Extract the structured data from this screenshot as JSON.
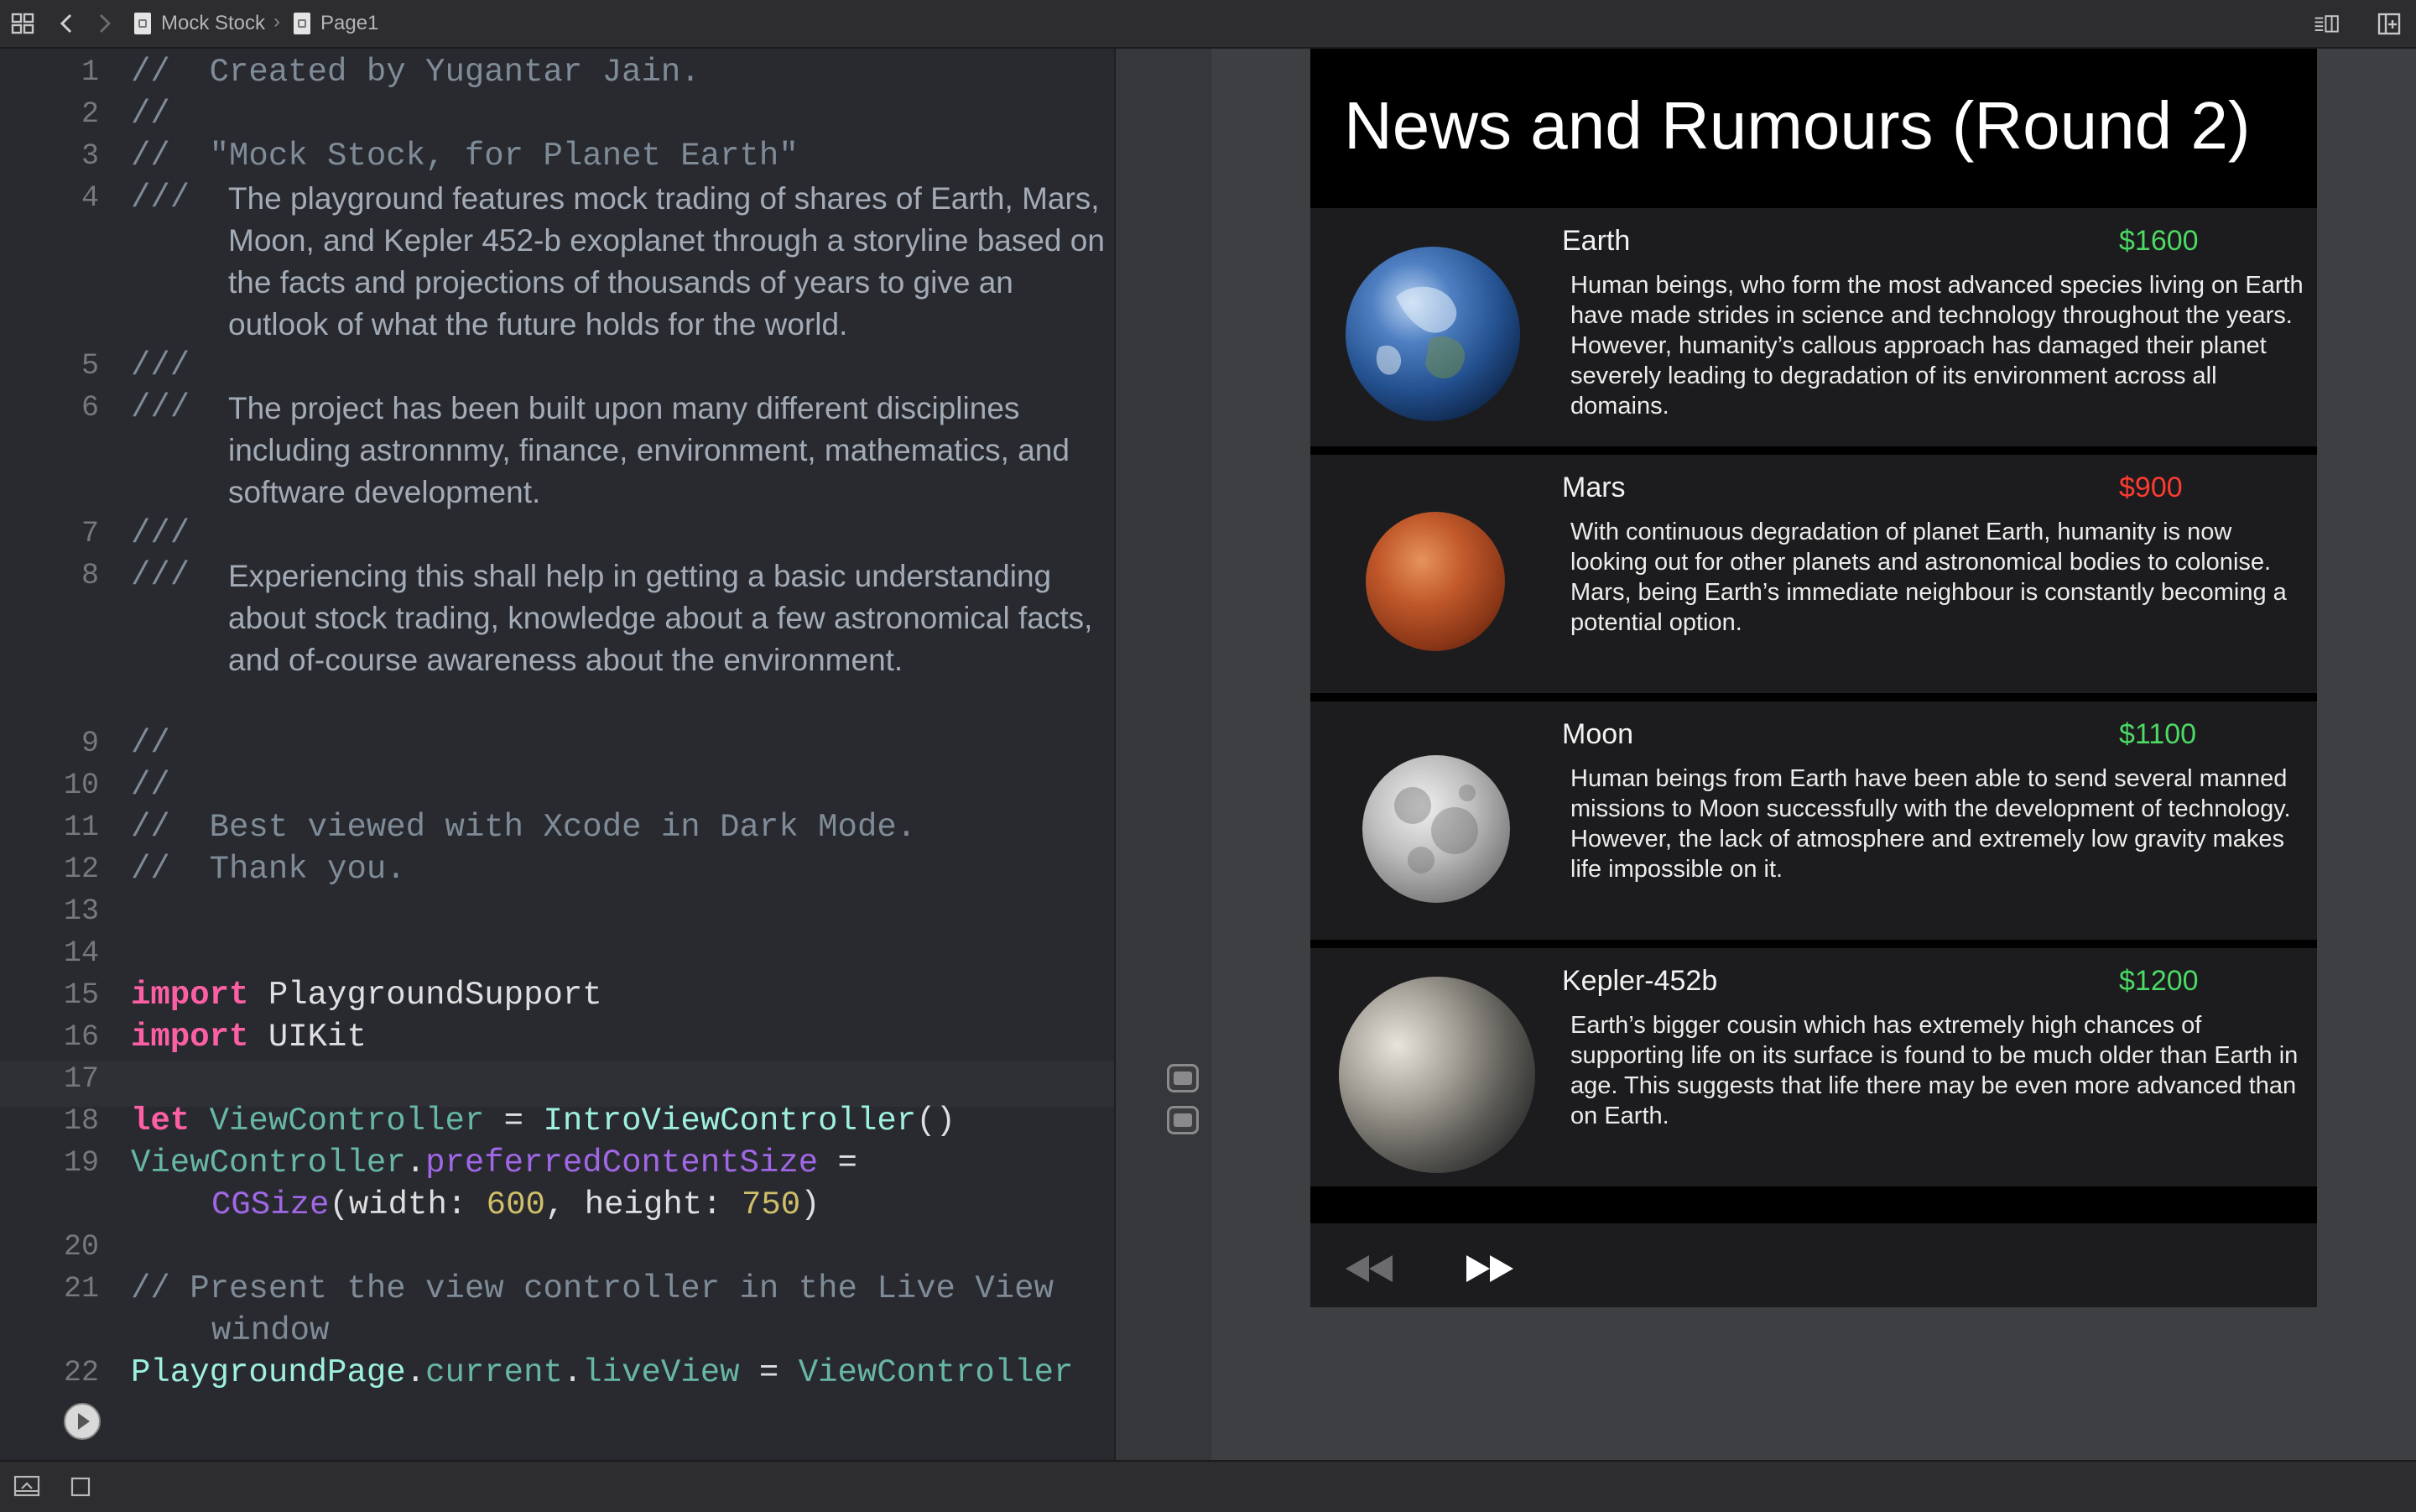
{
  "toolbar": {
    "breadcrumb": [
      {
        "label": "Mock Stock"
      },
      {
        "label": "Page1"
      }
    ],
    "separator": "›"
  },
  "editor": {
    "line_numbers": [
      "1",
      "2",
      "3",
      "4",
      "5",
      "6",
      "7",
      "8",
      "9",
      "10",
      "11",
      "12",
      "13",
      "14",
      "15",
      "16",
      "17",
      "18",
      "19",
      "20",
      "21",
      "22"
    ],
    "lines": {
      "l1": "//  Created by Yugantar Jain.",
      "l2": "//",
      "l3": "//  \"Mock Stock, for Planet Earth\"",
      "l4_marker": "///",
      "l4_doc": "The playground features mock trading of shares of Earth, Mars, Moon, and Kepler 452-b exoplanet through a storyline based on the facts and projections of thousands of years to give an outlook of what the future holds for the world.",
      "l5": "///",
      "l6_marker": "///",
      "l6_doc": "The project has been built upon many different disciplines including astronnmy, finance, environment, mathematics, and software development.",
      "l7": "///",
      "l8_marker": "///",
      "l8_doc": "Experiencing this shall help in getting a basic understanding about stock trading, knowledge about a few astronomical facts, and of-course awareness about the environment.",
      "l9": "//",
      "l10": "//",
      "l11": "//  Best viewed with Xcode in Dark Mode.",
      "l12": "//  Thank you.",
      "l15_kw": "import",
      "l15_rest": " PlaygroundSupport",
      "l16_kw": "import",
      "l16_rest": " UIKit",
      "l18_kw": "let",
      "l18_var": "ViewController",
      "l18_eq": " = ",
      "l18_type": "IntroViewController",
      "l18_end": "()",
      "l19_var": "ViewController",
      "l19_dot": ".",
      "l19_prop": "preferredContentSize",
      "l19_end": " =",
      "l19b_type": "CGSize",
      "l19b_a": "(width: ",
      "l19b_w": "600",
      "l19b_b": ", height: ",
      "l19b_h": "750",
      "l19b_c": ")",
      "l21a": "// Present the view controller in the Live View",
      "l21b": "window",
      "l22_type": "PlaygroundPage",
      "l22_d1": ".",
      "l22_p1": "current",
      "l22_d2": ".",
      "l22_p2": "liveView",
      "l22_eq": " = ",
      "l22_var": "ViewController"
    }
  },
  "live_view": {
    "title": "News and Rumours (Round 2)",
    "colors": {
      "price_up": "#4cd964",
      "price_down": "#ff3b30"
    },
    "cards": [
      {
        "name": "Earth",
        "price": "$1600",
        "trend": "up",
        "desc": "Human beings, who form the most advanced species living on Earth have made strides in science and technology throughout the years. However, humanity’s callous approach has damaged their planet severely leading to degradation of its environment across all domains.",
        "icon": "earth-image"
      },
      {
        "name": "Mars",
        "price": "$900",
        "trend": "down",
        "desc": "With continuous degradation of planet Earth, humanity is now looking out for other planets and astronomical bodies to colonise. Mars, being Earth’s immediate neighbour is constantly becoming a potential option.",
        "icon": "mars-image"
      },
      {
        "name": "Moon",
        "price": "$1100",
        "trend": "up",
        "desc": "Human beings from Earth have been able to send several manned missions to Moon successfully with the development of technology. However, the lack of atmosphere and extremely low gravity makes life impossible on it.",
        "icon": "moon-image"
      },
      {
        "name": "Kepler-452b",
        "price": "$1200",
        "trend": "up",
        "desc": "Earth’s bigger cousin which has extremely high chances of supporting life on its surface is found to be much older than Earth in age. This suggests that life there may be even more advanced than on Earth.",
        "icon": "kepler-image"
      }
    ],
    "controls": {
      "previous_icon": "rewind-icon",
      "next_icon": "fast-forward-icon"
    }
  }
}
